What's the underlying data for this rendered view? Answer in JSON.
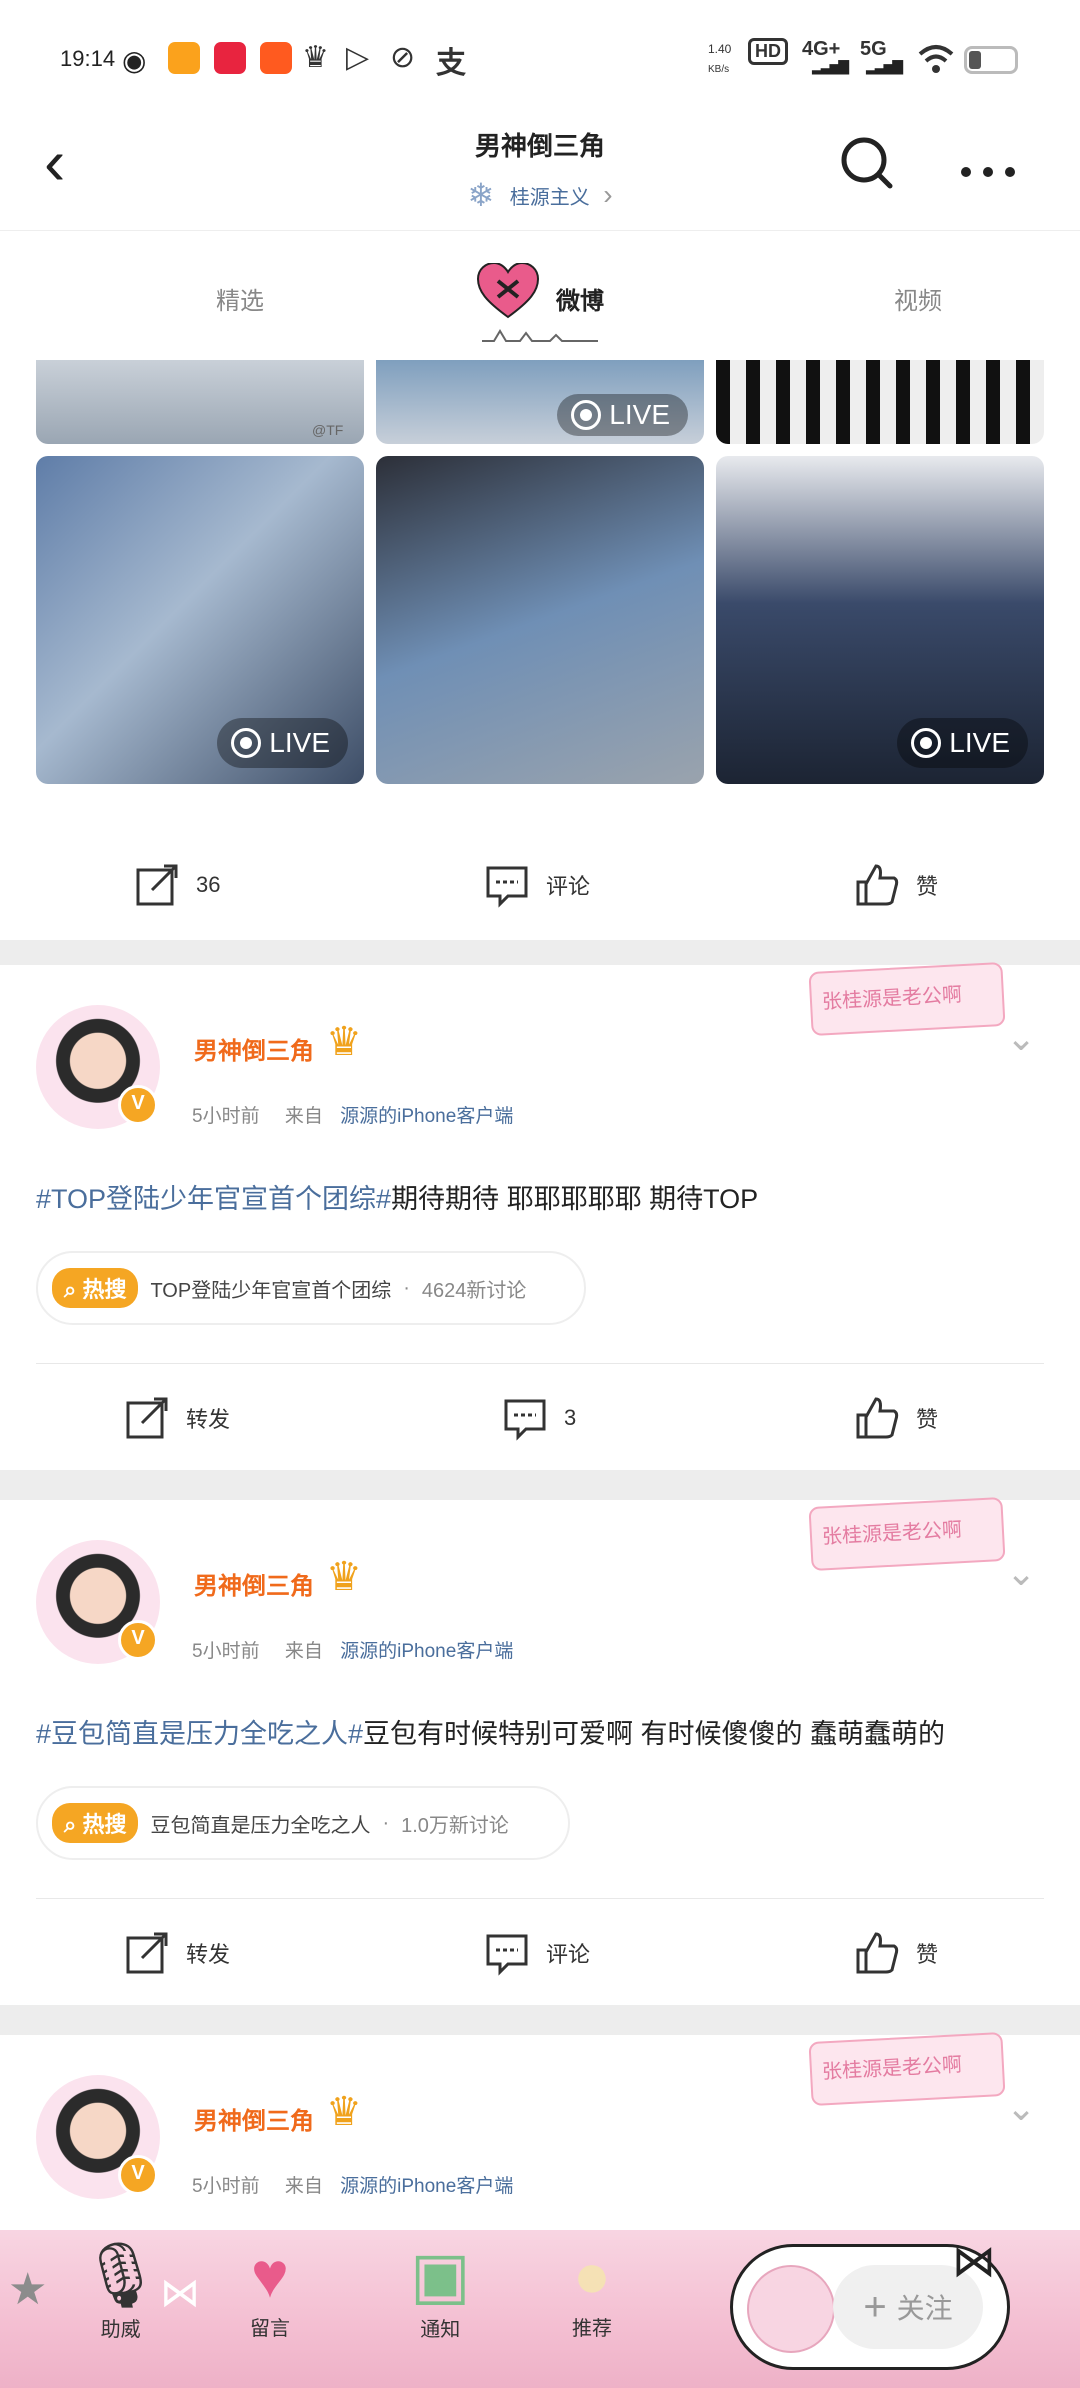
{
  "status_bar": {
    "time": "19:14",
    "speed": "1.40",
    "speed_unit": "KB/s",
    "hd": "HD",
    "signal1": "4G+",
    "signal2": "5G",
    "app_icons": [
      "weibo-icon",
      "bilibili-icon",
      "xiaohongshu-icon",
      "taobao-icon",
      "crown-icon",
      "video-icon",
      "leaf-icon",
      "alipay-icon"
    ]
  },
  "header": {
    "title": "男神倒三角",
    "subtitle": "桂源主义",
    "subtitle_arrow": "›"
  },
  "tabs": [
    {
      "label": "精选"
    },
    {
      "label": "微博"
    },
    {
      "label": "视频"
    }
  ],
  "live_label": "LIVE",
  "watermark": "@TF",
  "post0": {
    "actions": {
      "repost": "36",
      "comment": "评论",
      "like": "赞"
    }
  },
  "posts": [
    {
      "username": "男神倒三角",
      "time": "5小时前",
      "from": "来自",
      "source": "源源的iPhone客户端",
      "tag": "#TOP登陆少年官宣首个团综#",
      "text": "期待期待  耶耶耶耶耶  期待TOP",
      "hot_badge": "热搜",
      "hot_topic": "TOP登陆少年官宣首个团综",
      "hot_dot": "·",
      "hot_count": "4624新讨论",
      "actions": {
        "repost": "转发",
        "comment": "3",
        "like": "赞"
      },
      "deco": "张桂源是老公啊"
    },
    {
      "username": "男神倒三角",
      "time": "5小时前",
      "from": "来自",
      "source": "源源的iPhone客户端",
      "tag": "#豆包简直是压力全吃之人#",
      "text": "豆包有时候特别可爱啊  有时候傻傻的  蠢萌蠢萌的",
      "hot_badge": "热搜",
      "hot_topic": "豆包简直是压力全吃之人",
      "hot_dot": "·",
      "hot_count": "1.0万新讨论",
      "actions": {
        "repost": "转发",
        "comment": "评论",
        "like": "赞"
      },
      "deco": "张桂源是老公啊"
    },
    {
      "username": "男神倒三角",
      "time": "5小时前",
      "from": "来自",
      "source": "源源的iPhone客户端",
      "deco": "张桂源是老公啊"
    }
  ],
  "bottom_nav": [
    {
      "label": "助威"
    },
    {
      "label": "留言"
    },
    {
      "label": "通知"
    },
    {
      "label": "推荐"
    }
  ],
  "follow_button": "关注",
  "follow_plus": "+"
}
